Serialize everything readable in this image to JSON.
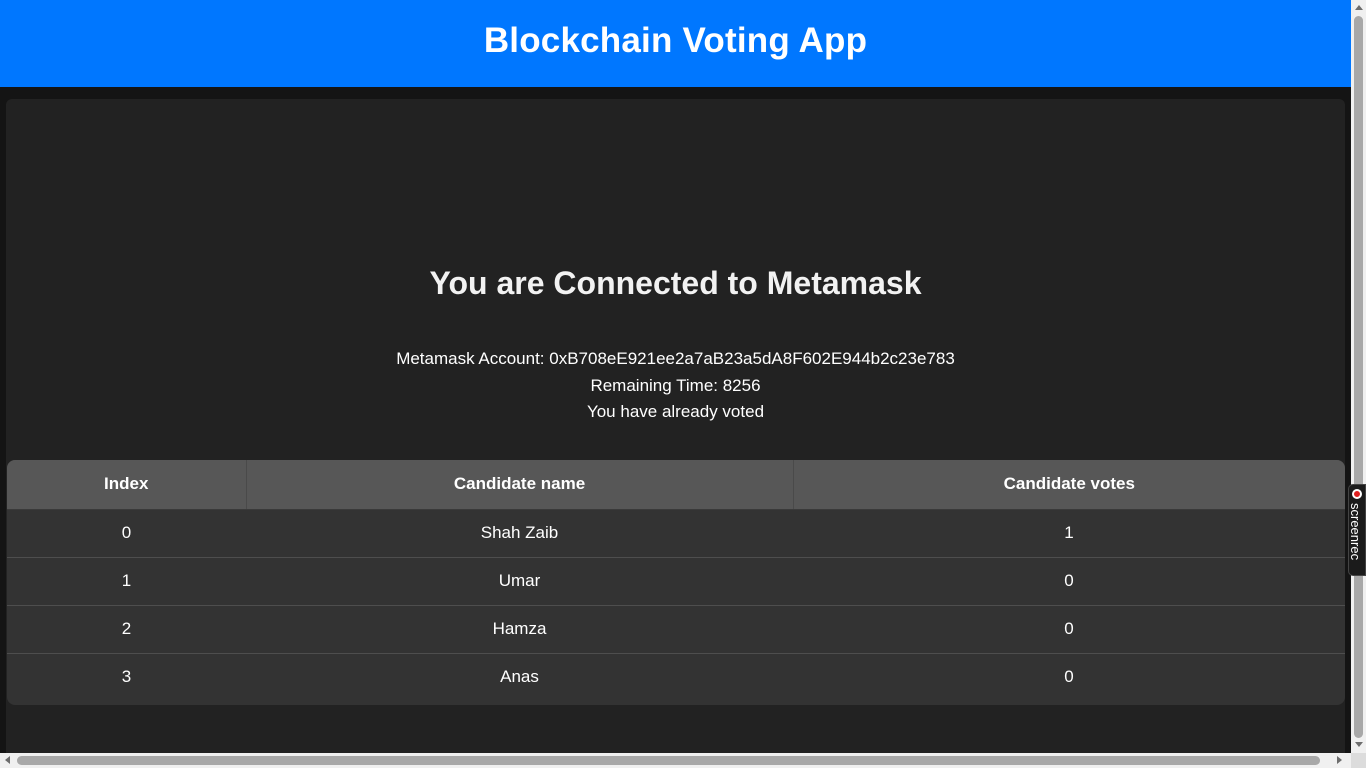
{
  "header": {
    "title": "Blockchain Voting App"
  },
  "status": {
    "heading": "You are Connected to Metamask",
    "account_line": "Metamask Account: 0xB708eE921ee2a7aB23a5dA8F602E944b2c23e783",
    "remaining_line": "Remaining Time: 8256",
    "voted_line": "You have already voted"
  },
  "table": {
    "columns": [
      "Index",
      "Candidate name",
      "Candidate votes"
    ],
    "rows": [
      {
        "index": "0",
        "name": "Shah Zaib",
        "votes": "1"
      },
      {
        "index": "1",
        "name": "Umar",
        "votes": "0"
      },
      {
        "index": "2",
        "name": "Hamza",
        "votes": "0"
      },
      {
        "index": "3",
        "name": "Anas",
        "votes": "0"
      }
    ]
  },
  "overlay": {
    "recorder_label": "screenrec"
  },
  "colors": {
    "header_bg": "#0077ff",
    "panel_bg": "#222222",
    "table_head_bg": "#575757",
    "table_body_bg": "#333333"
  }
}
